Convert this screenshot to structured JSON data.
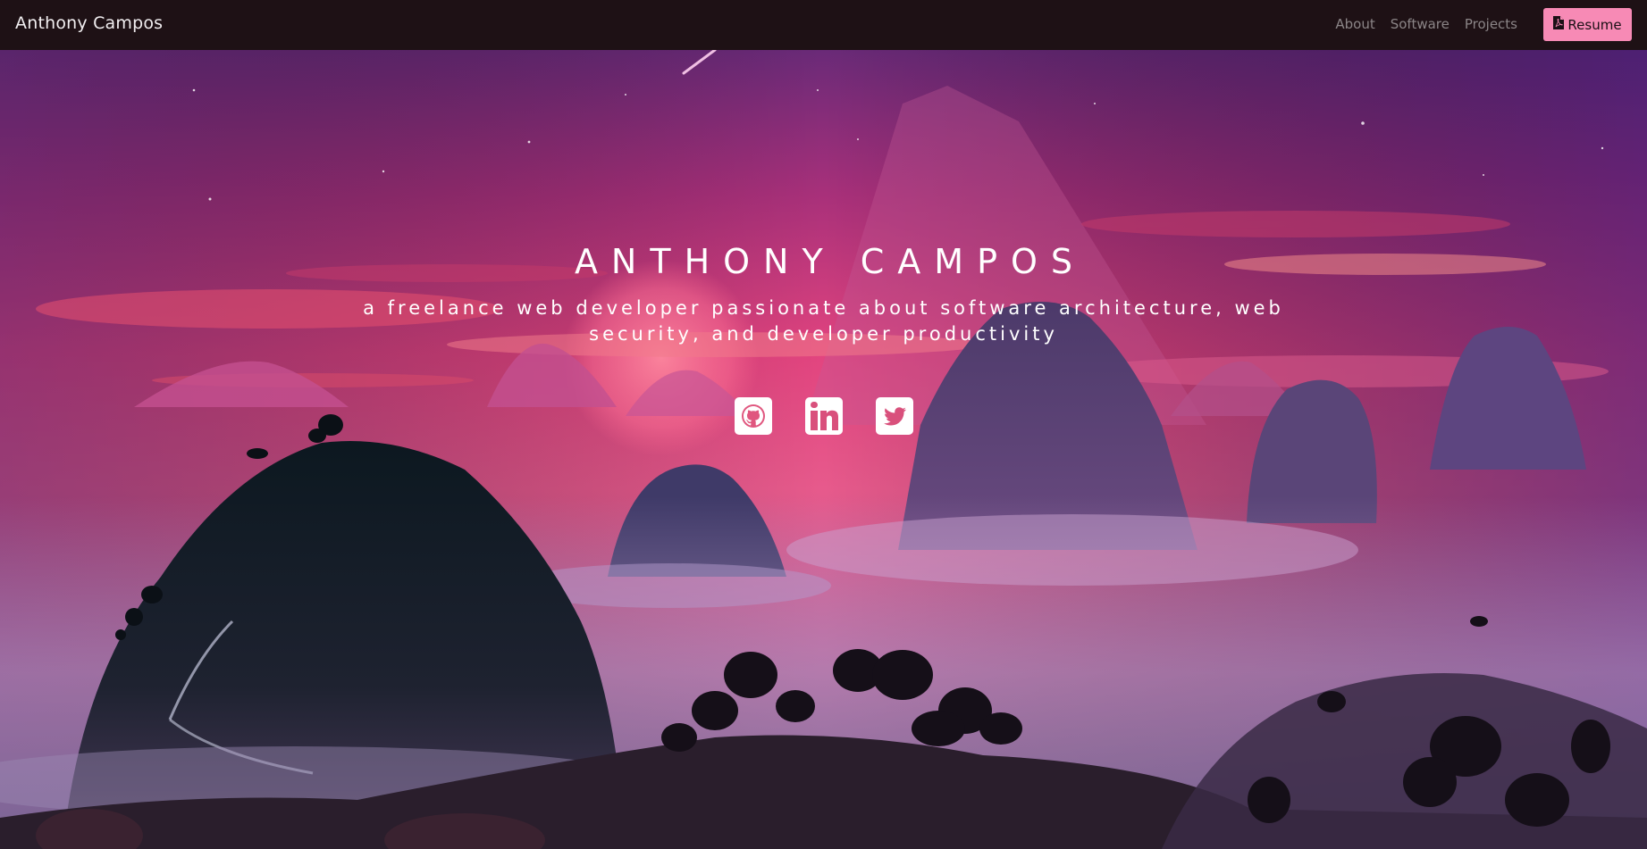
{
  "navbar": {
    "brand": "Anthony Campos",
    "links": [
      {
        "label": "About"
      },
      {
        "label": "Software"
      },
      {
        "label": "Projects"
      }
    ],
    "resume": {
      "label": "Resume",
      "icon": "pdf-file-icon",
      "color": "#f78ab5"
    }
  },
  "hero": {
    "title": "ANTHONY CAMPOS",
    "subtitle": "a freelance web developer passionate about software architecture, web security, and developer productivity"
  },
  "socials": [
    {
      "icon": "github-icon"
    },
    {
      "icon": "linkedin-icon"
    },
    {
      "icon": "twitter-icon"
    }
  ],
  "colors": {
    "navbar_bg": "#1e1115",
    "accent": "#f78ab5",
    "sky_top": "#5a2a7a",
    "sky_mid": "#e0407e"
  }
}
